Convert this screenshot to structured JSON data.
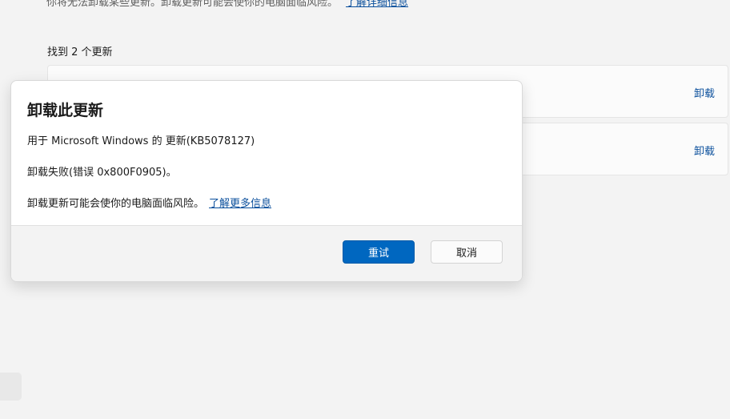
{
  "background": {
    "notice_text": "你将无法卸载某些更新。卸载更新可能会使你的电脑面临风险。",
    "notice_link": "了解详细信息",
    "found_label": "找到 2 个更新",
    "updates": [
      {
        "action_label": "卸载"
      },
      {
        "action_label": "卸载"
      }
    ]
  },
  "dialog": {
    "title": "卸载此更新",
    "update_name": "用于 Microsoft Windows 的 更新(KB5078127)",
    "error_message": "卸载失败(错误 0x800F0905)。",
    "risk_text": "卸载更新可能会使你的电脑面临风险。",
    "risk_link": "了解更多信息",
    "retry_label": "重试",
    "cancel_label": "取消"
  },
  "colors": {
    "accent": "#0067c0",
    "link": "#0a4f9c",
    "page_background": "#f3f3f3"
  }
}
